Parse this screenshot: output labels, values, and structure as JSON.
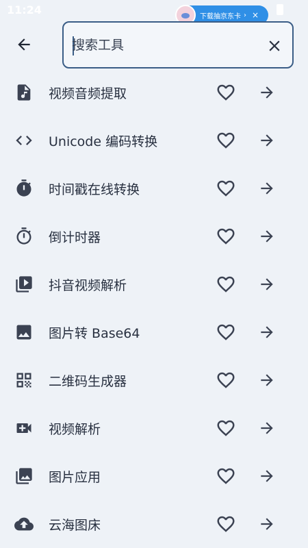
{
  "status_bar": {
    "time": "11:24"
  },
  "ad": {
    "text": "下载抽京东卡",
    "chevron": "›",
    "close": "×"
  },
  "header": {
    "back_icon": "arrow-left-icon",
    "search": {
      "placeholder": "搜索工具",
      "value": ""
    },
    "clear_icon": "close-icon"
  },
  "tools": [
    {
      "label": "视频音频提取",
      "icon": "audio-file-icon"
    },
    {
      "label": "Unicode 编码转换",
      "icon": "code-icon"
    },
    {
      "label": "时间戳在线转换",
      "icon": "timer-filled-icon"
    },
    {
      "label": "倒计时器",
      "icon": "timer-outline-icon"
    },
    {
      "label": "抖音视频解析",
      "icon": "video-library-icon"
    },
    {
      "label": "图片转 Base64",
      "icon": "image-icon"
    },
    {
      "label": "二维码生成器",
      "icon": "qr-code-icon"
    },
    {
      "label": "视频解析",
      "icon": "video-camera-icon"
    },
    {
      "label": "图片应用",
      "icon": "photo-library-icon"
    },
    {
      "label": "云海图床",
      "icon": "cloud-upload-icon"
    }
  ],
  "colors": {
    "background": "#eef2f7",
    "icon": "#3b4252",
    "search_border": "#3a5d86",
    "ad": "#2f8fe6"
  }
}
